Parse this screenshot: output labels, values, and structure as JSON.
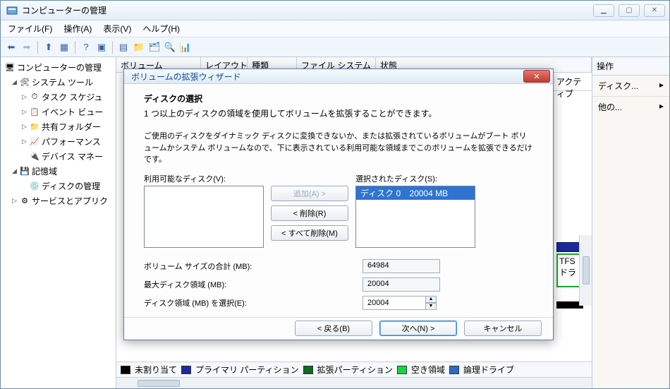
{
  "window": {
    "title": "コンピューターの管理",
    "min": "▁",
    "max": "▢",
    "close": "✕"
  },
  "menu": {
    "file": "ファイル(F)",
    "action": "操作(A)",
    "view": "表示(V)",
    "help": "ヘルプ(H)"
  },
  "tree": {
    "root": "コンピューターの管理",
    "systools": "システム ツール",
    "task": "タスク スケジュ",
    "event": "イベント ビュー",
    "shared": "共有フォルダー",
    "perf": "パフォーマンス",
    "device": "デバイス マネー",
    "storage": "記憶域",
    "diskmgmt": "ディスクの管理",
    "services": "サービスとアプリク"
  },
  "grid": {
    "cols": {
      "volume": "ボリューム",
      "layout": "レイアウト",
      "type": "種類",
      "fs": "ファイル システム",
      "status": "状態",
      "extra": "アクティブ"
    }
  },
  "legend": {
    "unalloc": "未割り当て",
    "primary": "プライマリ パーティション",
    "extended": "拡張パーティション",
    "free": "空き領域",
    "logical": "論理ドライブ"
  },
  "actions": {
    "header": "操作",
    "disk": "ディスク...",
    "more": "他の...",
    "chev": "▸"
  },
  "peek": {
    "ntfs": "TFS",
    "dra": "ドラ"
  },
  "dialog": {
    "title": "ボリュームの拡張ウィザード",
    "subtitle": "ディスクの選択",
    "desc": "1 つ以上のディスクの領域を使用してボリュームを拡張することができます。",
    "note": "ご使用のディスクをダイナミック ディスクに変換できないか、または拡張されているボリュームがブート ボリュームかシステム ボリュームなので、下に表示されている利用可能な領域までこのボリュームを拡張できるだけです。",
    "avail_label": "利用可能なディスク(V):",
    "selected_label": "選択されたディスク(S):",
    "selected_items": [
      {
        "name": "ディスク 0",
        "size": "20004 MB"
      }
    ],
    "btn_add": "追加(A) >",
    "btn_remove": "< 削除(R)",
    "btn_remove_all": "< すべて削除(M)",
    "field_total": "ボリューム サイズの合計 (MB):",
    "field_total_val": "64984",
    "field_max": "最大ディスク領域 (MB):",
    "field_max_val": "20004",
    "field_sel": "ディスク領域 (MB) を選択(E):",
    "field_sel_val": "20004",
    "btn_back": "< 戻る(B)",
    "btn_next": "次へ(N) >",
    "btn_cancel": "キャンセル"
  },
  "colors": {
    "unalloc": "#000000",
    "primary": "#1a2a9c",
    "extended": "#0b6b1e",
    "free": "#16d63f",
    "logical": "#2a6bc6"
  }
}
